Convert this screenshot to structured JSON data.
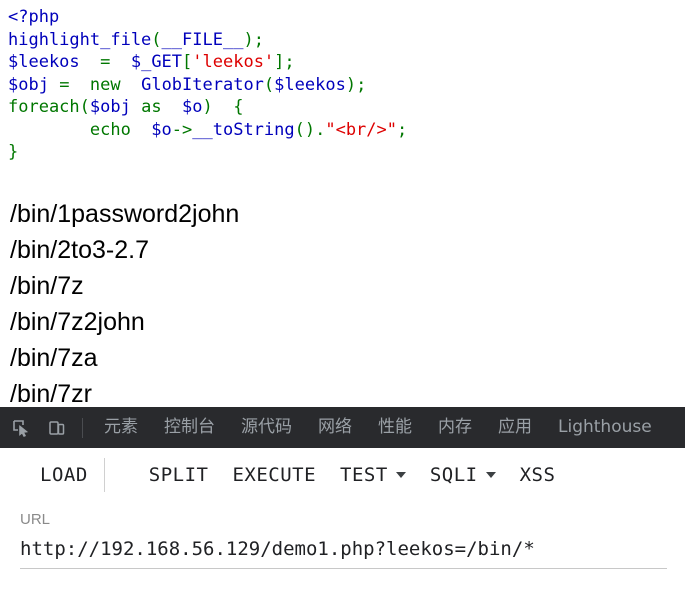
{
  "page": {
    "code_lines": [
      [
        {
          "t": "<?php",
          "c": "tok-default"
        }
      ],
      [
        {
          "t": "highlight_file",
          "c": "tok-default"
        },
        {
          "t": "(",
          "c": "tok-keyword"
        },
        {
          "t": "__FILE__",
          "c": "tok-default"
        },
        {
          "t": ")",
          "c": "tok-keyword"
        },
        {
          "t": ";",
          "c": "tok-keyword"
        }
      ],
      [
        {
          "t": "$leekos",
          "c": "tok-default"
        },
        {
          "t": "  =  ",
          "c": "tok-keyword"
        },
        {
          "t": "$_GET",
          "c": "tok-default"
        },
        {
          "t": "[",
          "c": "tok-keyword"
        },
        {
          "t": "'leekos'",
          "c": "tok-string"
        },
        {
          "t": "]",
          "c": "tok-keyword"
        },
        {
          "t": ";",
          "c": "tok-keyword"
        }
      ],
      [
        {
          "t": "$obj",
          "c": "tok-default"
        },
        {
          "t": " = ",
          "c": "tok-keyword"
        },
        {
          "t": " new ",
          "c": "tok-keyword"
        },
        {
          "t": " GlobIterator",
          "c": "tok-default"
        },
        {
          "t": "(",
          "c": "tok-keyword"
        },
        {
          "t": "$leekos",
          "c": "tok-default"
        },
        {
          "t": ")",
          "c": "tok-keyword"
        },
        {
          "t": ";",
          "c": "tok-keyword"
        }
      ],
      [
        {
          "t": "foreach",
          "c": "tok-keyword"
        },
        {
          "t": "(",
          "c": "tok-keyword"
        },
        {
          "t": "$obj",
          "c": "tok-default"
        },
        {
          "t": " as ",
          "c": "tok-keyword"
        },
        {
          "t": " $o",
          "c": "tok-default"
        },
        {
          "t": ")  {",
          "c": "tok-keyword"
        }
      ],
      [
        {
          "t": "        echo  ",
          "c": "tok-keyword"
        },
        {
          "t": "$o",
          "c": "tok-default"
        },
        {
          "t": "->",
          "c": "tok-keyword"
        },
        {
          "t": "__toString",
          "c": "tok-default"
        },
        {
          "t": "().",
          "c": "tok-keyword"
        },
        {
          "t": "\"<br/>\"",
          "c": "tok-string"
        },
        {
          "t": ";",
          "c": "tok-keyword"
        }
      ],
      [
        {
          "t": "}",
          "c": "tok-keyword"
        }
      ]
    ],
    "file_list": [
      "/bin/1password2john",
      "/bin/2to3-2.7",
      "/bin/7z",
      "/bin/7z2john",
      "/bin/7za",
      "/bin/7zr"
    ]
  },
  "devtools": {
    "inspect_icon": "inspect-element-icon",
    "device_icon": "device-toolbar-icon",
    "tabs": [
      {
        "label": "元素"
      },
      {
        "label": "控制台"
      },
      {
        "label": "源代码"
      },
      {
        "label": "网络"
      },
      {
        "label": "性能"
      },
      {
        "label": "内存"
      },
      {
        "label": "应用"
      },
      {
        "label": "Lighthouse"
      }
    ],
    "background_color": "#292a2d",
    "tab_color": "#9aa0a6"
  },
  "hackbar": {
    "buttons": [
      {
        "label": "LOAD",
        "caret": false
      },
      {
        "label": "",
        "caret": true,
        "caret_only": true
      },
      {
        "label": "SPLIT",
        "caret": false
      },
      {
        "label": "EXECUTE",
        "caret": false
      },
      {
        "label": "TEST",
        "caret": true
      },
      {
        "label": "SQLI",
        "caret": true
      },
      {
        "label": "XSS",
        "caret": false
      }
    ],
    "url_label": "URL",
    "url_value": "http://192.168.56.129/demo1.php?leekos=/bin/*",
    "url_placeholder": "URL"
  }
}
